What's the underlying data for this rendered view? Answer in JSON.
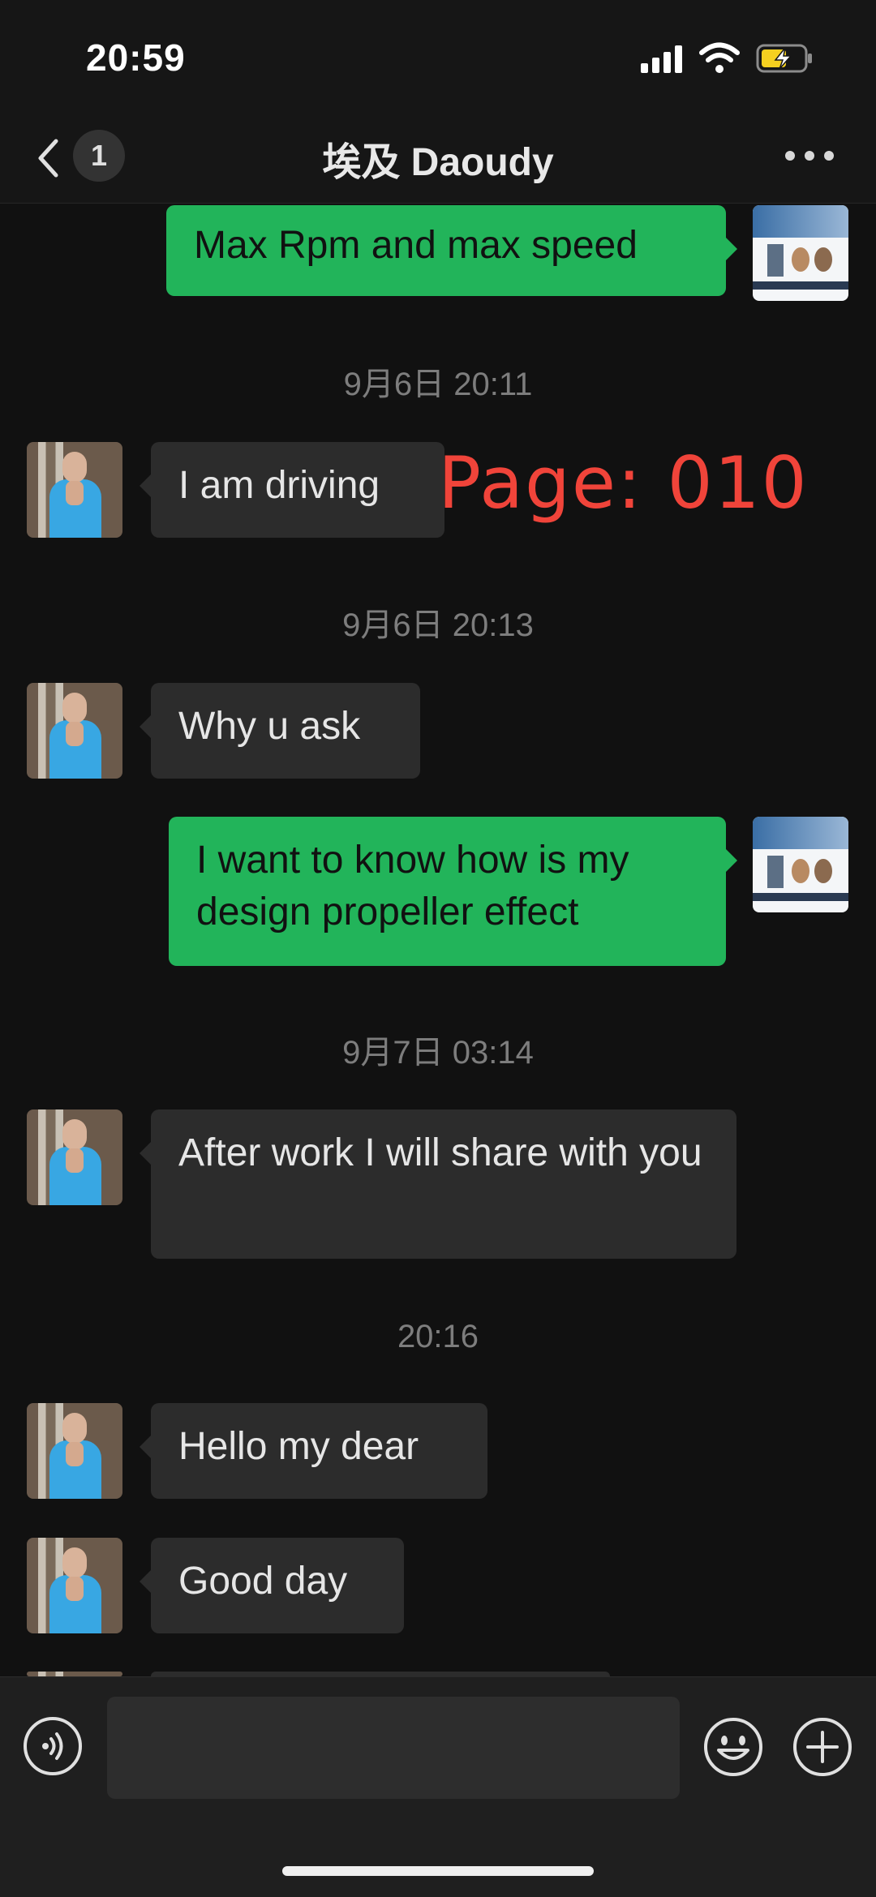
{
  "status_bar": {
    "time": "20:59"
  },
  "header": {
    "unread_count": "1",
    "title": "埃及 Daoudy"
  },
  "watermark": "Page: 010",
  "messages": [
    {
      "side": "out",
      "text": "Max Rpm and max speed"
    },
    {
      "type": "timestamp",
      "text": "9月6日 20:11"
    },
    {
      "side": "in",
      "text": "I am driving"
    },
    {
      "type": "timestamp",
      "text": "9月6日 20:13"
    },
    {
      "side": "in",
      "text": "Why u ask"
    },
    {
      "side": "out",
      "text": "I want to know how is my design propeller effect"
    },
    {
      "type": "timestamp",
      "text": "9月7日 03:14"
    },
    {
      "side": "in",
      "text": "After work I will share with you"
    },
    {
      "type": "timestamp",
      "text": "20:16"
    },
    {
      "side": "in",
      "text": "Hello my dear"
    },
    {
      "side": "in",
      "text": "Good day"
    }
  ],
  "input_bar": {
    "message_value": "",
    "icons": [
      "voice-icon",
      "emoji-icon",
      "plus-icon"
    ]
  }
}
